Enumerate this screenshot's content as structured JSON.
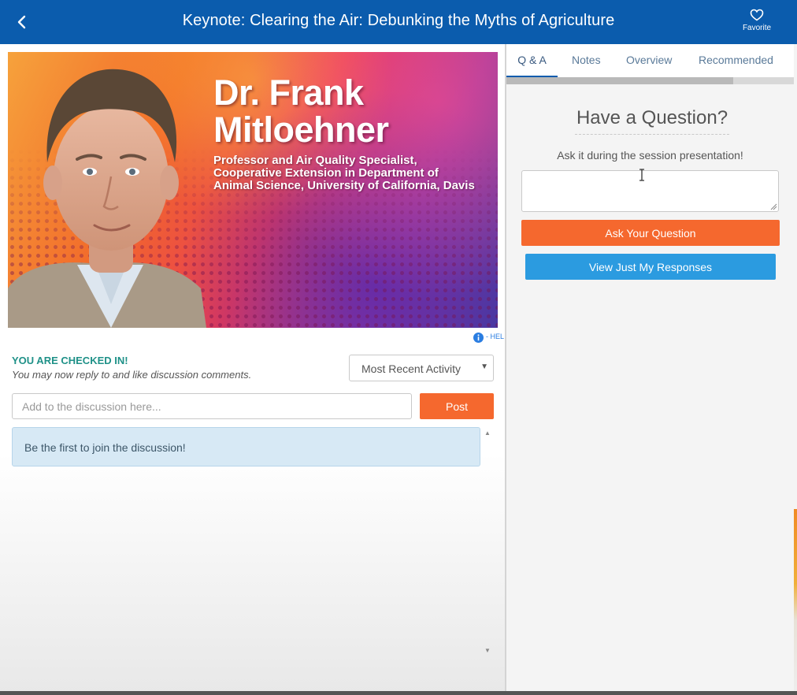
{
  "header": {
    "title": "Keynote: Clearing the Air: Debunking the Myths of Agriculture",
    "favorite_label": "Favorite"
  },
  "banner": {
    "name_line1": "Dr. Frank",
    "name_line2": "Mitloehner",
    "subtitle_line1": "Professor and Air Quality Specialist,",
    "subtitle_line2": "Cooperative Extension in Department of",
    "subtitle_line3": "Animal Science, University of California, Davis"
  },
  "help": {
    "label": "- HEL"
  },
  "discussion": {
    "status_title": "YOU ARE CHECKED IN!",
    "status_subtitle": "You may now reply to and like discussion comments.",
    "sort_selected": "Most Recent Activity",
    "input_placeholder": "Add to the discussion here...",
    "post_label": "Post",
    "empty_message": "Be the first to join the discussion!"
  },
  "tabs": [
    {
      "label": "Q & A",
      "active": true
    },
    {
      "label": "Notes",
      "active": false
    },
    {
      "label": "Overview",
      "active": false
    },
    {
      "label": "Recommended",
      "active": false
    }
  ],
  "tabs_scroll_fraction": 0.79,
  "qa": {
    "title": "Have a Question?",
    "subtitle": "Ask it during the session presentation!",
    "ask_label": "Ask Your Question",
    "responses_label": "View Just My Responses"
  },
  "colors": {
    "header": "#0b5cad",
    "accent_orange": "#f5682e",
    "accent_blue": "#2b9be0",
    "checked_in_teal": "#1f9188"
  },
  "icons": {
    "back": "chevron-left-icon",
    "favorite": "heart-outline-icon",
    "info": "info-icon",
    "sort": "caret-down-icon"
  }
}
